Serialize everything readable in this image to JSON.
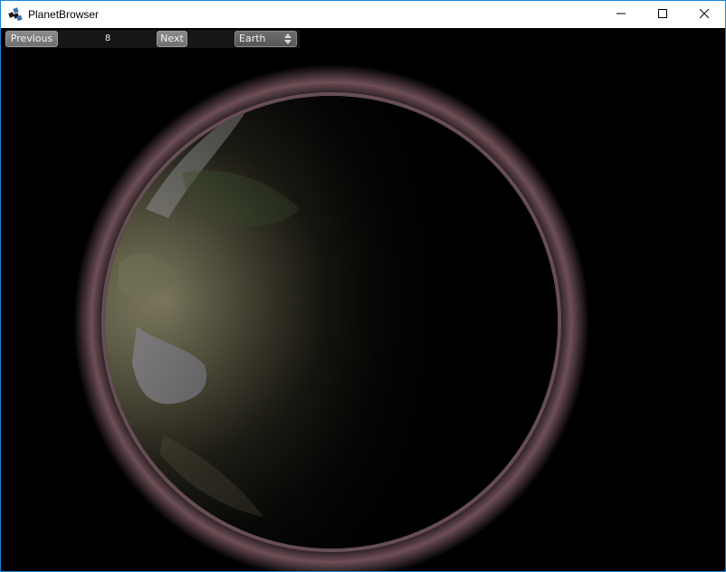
{
  "window": {
    "title": "PlanetBrowser",
    "icons": {
      "app": "app-logo-icon",
      "minimize": "minimize-icon",
      "maximize": "maximize-icon",
      "close": "close-icon"
    }
  },
  "toolbar": {
    "previous_label": "Previous",
    "counter": "8",
    "next_label": "Next",
    "planet_select": {
      "selected": "Earth",
      "icon": "up-down-arrows-icon"
    }
  },
  "colors": {
    "window_border": "#1883d7",
    "viewport_background": "#000000",
    "atmosphere_glow": "#c8909e"
  }
}
